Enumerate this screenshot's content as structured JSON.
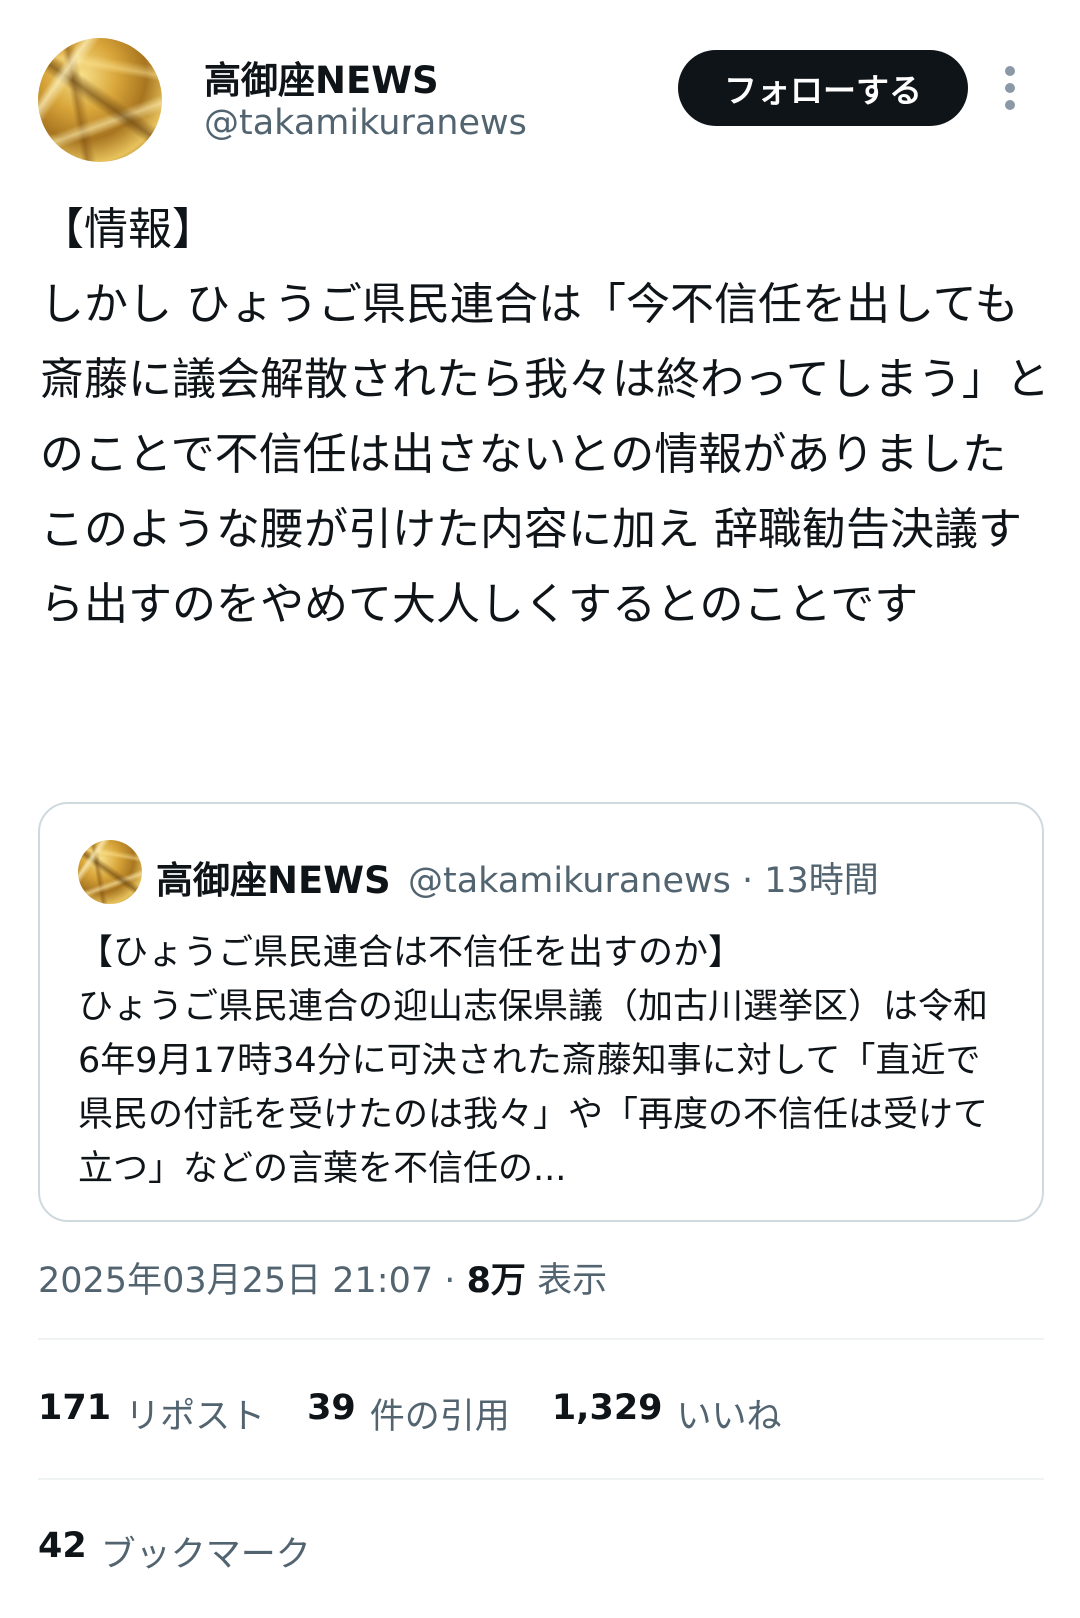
{
  "author": {
    "display_name": "高御座NEWS",
    "handle": "@takamikuranews"
  },
  "follow_button": {
    "label": "フォローする"
  },
  "tweet": {
    "text": "【情報】\nしかし ひょうご県民連合は「今不信任を出しても斎藤に議会解散されたら我々は終わってしまう」とのことで不信任は出さないとの情報がありました\nこのような腰が引けた内容に加え 辞職勧告決議すら出すのをやめて大人しくするとのことです"
  },
  "quote": {
    "display_name": "高御座NEWS",
    "meta": "@takamikuranews · 13時間",
    "text": "【ひょうご県民連合は不信任を出すのか】\nひょうご県民連合の迎山志保県議（加古川選挙区）は令和6年9月17時34分に可決された斎藤知事に対して「直近で県民の付託を受けたのは我々」や「再度の不信任は受けて立つ」などの言葉を不信任の..."
  },
  "timestamp": {
    "datetime": "2025年03月25日 21:07",
    "separator": "·",
    "views": "8万",
    "views_label": "表示"
  },
  "stats": {
    "reposts": {
      "count": "171",
      "label": "リポスト"
    },
    "quotes": {
      "count": "39",
      "label": "件の引用"
    },
    "likes": {
      "count": "1,329",
      "label": "いいね"
    },
    "bookmarks": {
      "count": "42",
      "label": "ブックマーク"
    }
  },
  "colors": {
    "text_primary": "#0f1419",
    "text_secondary": "#536471",
    "button_bg": "#0f1419",
    "border": "#cfd9de"
  }
}
